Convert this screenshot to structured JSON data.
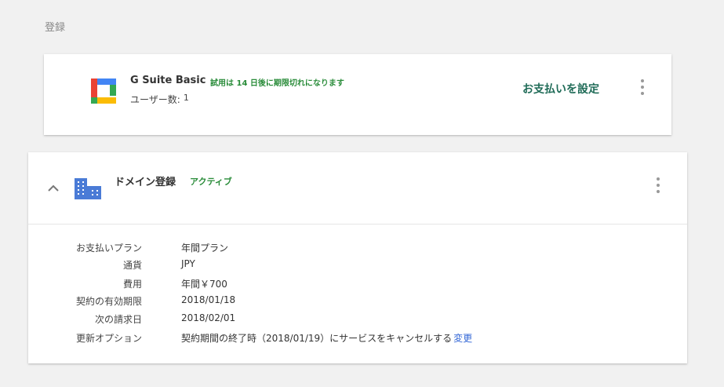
{
  "header": {
    "title": "登録"
  },
  "subscription": {
    "product_name": "G Suite Basic",
    "trial_notice": "試用は 14 日後に期限切れになります",
    "users_label": "ユーザー数:",
    "users_count": "1",
    "setup_payment_label": "お支払いを設定",
    "icon": "gsuite-logo"
  },
  "domain": {
    "title": "ドメイン登録",
    "status": "アクティブ",
    "icon": "building-icon",
    "details": [
      {
        "label": "お支払いプラン",
        "value": "年間プラン"
      },
      {
        "label": "通貨",
        "value": "JPY"
      },
      {
        "label": "費用",
        "value": "年間￥700"
      },
      {
        "label": "契約の有効期限",
        "value": "2018/01/18"
      },
      {
        "label": "次の請求日",
        "value": "2018/02/01"
      },
      {
        "label": "更新オプション",
        "value": "契約期間の終了時（2018/01/19）にサービスをキャンセルする"
      }
    ],
    "change_link": "変更"
  },
  "colors": {
    "accent_green": "#1f6b57",
    "status_green": "#2a8c3a",
    "link_blue": "#3367d6",
    "building_blue": "#4a7bd6"
  }
}
